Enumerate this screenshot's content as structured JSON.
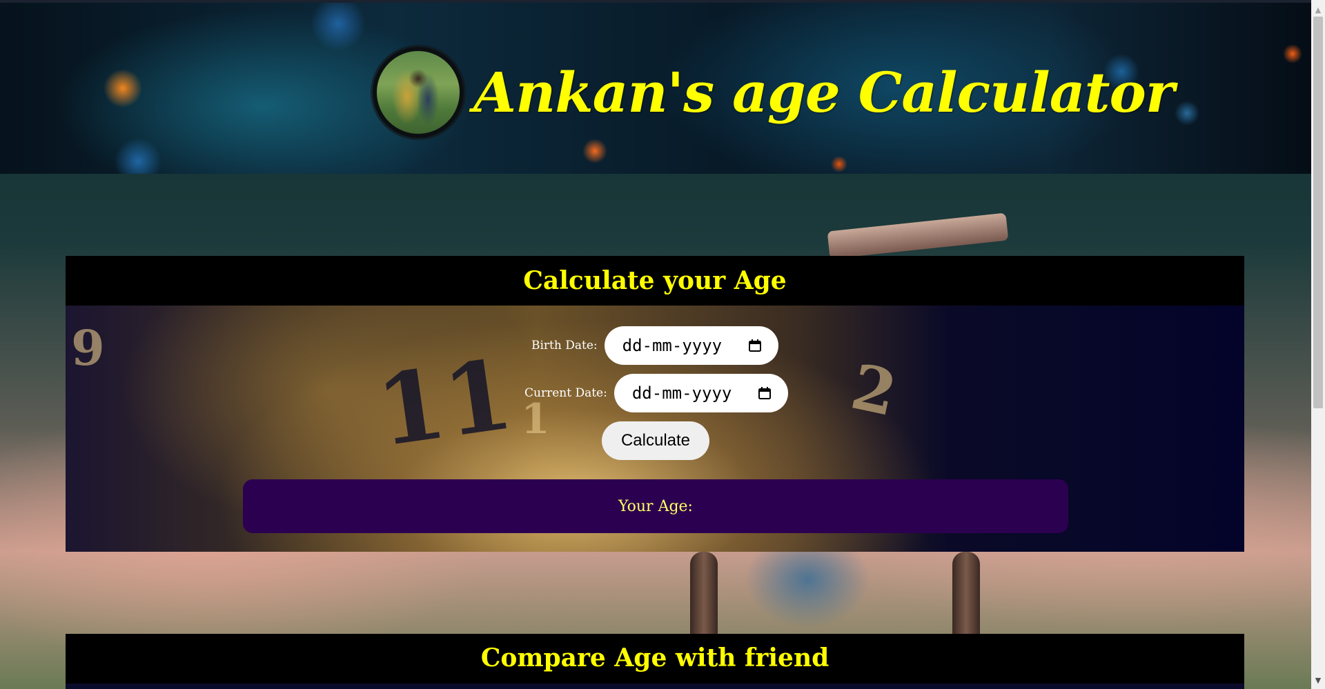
{
  "header": {
    "title": "Ankan's age Calculator"
  },
  "calculator": {
    "heading": "Calculate your Age",
    "birth_label": "Birth Date:",
    "birth_value": "dd-mm-yyyy",
    "current_label": "Current Date:",
    "current_value": "dd-mm-yyyy",
    "calculate_label": "Calculate",
    "result_label": "Your Age:"
  },
  "compare": {
    "heading": "Compare Age with friend"
  },
  "colors": {
    "heading_accent": "#ffff00",
    "result_bg": "#2c0050",
    "card_head_bg": "#000000"
  },
  "icons": {
    "date_picker": "calendar-icon",
    "scroll_up": "arrow-up-icon",
    "scroll_down": "arrow-down-icon"
  }
}
